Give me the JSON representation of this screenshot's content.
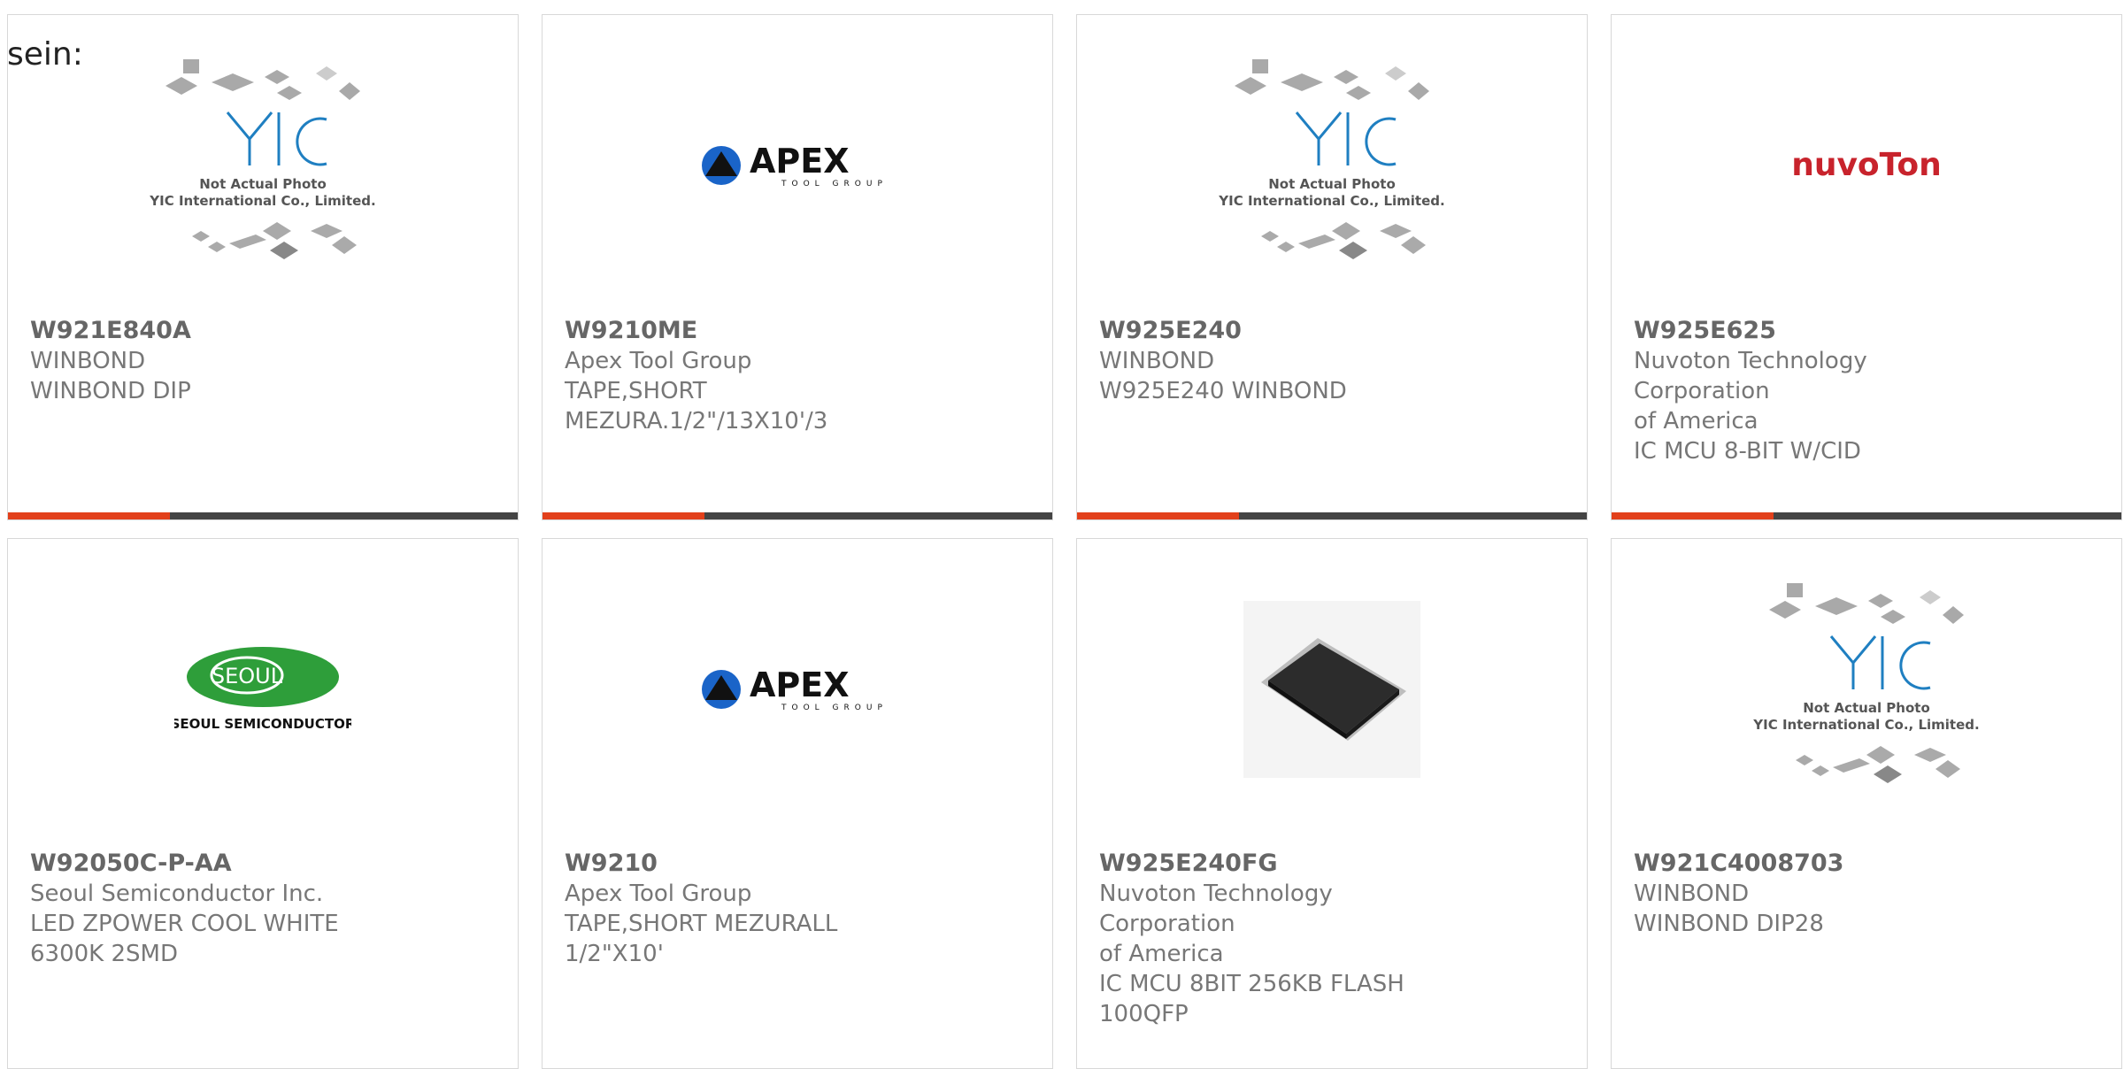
{
  "lead_text": "sein:",
  "yic_placeholder": {
    "line1": "Not Actual Photo",
    "line2": "YIC International Co., Limited."
  },
  "colors": {
    "accent": "#e2401b",
    "bar": "#444444",
    "text": "#666666"
  },
  "products": [
    {
      "part": "W921E840A",
      "maker": "WINBOND",
      "desc1": "WINBOND DIP",
      "desc2": "",
      "desc3": "",
      "image": "yic-placeholder"
    },
    {
      "part": "W9210ME",
      "maker": "Apex Tool Group",
      "desc1": "TAPE,SHORT",
      "desc2": "MEZURA.1/2\"/13X10'/3",
      "desc3": "",
      "image": "apex-logo"
    },
    {
      "part": "W925E240",
      "maker": "WINBOND",
      "desc1": "W925E240 WINBOND",
      "desc2": "",
      "desc3": "",
      "image": "yic-placeholder"
    },
    {
      "part": "W925E625",
      "maker": "Nuvoton Technology Corporation",
      "desc1": "of America",
      "desc2": "IC MCU 8-BIT W/CID",
      "desc3": "",
      "image": "nuvoton-logo"
    },
    {
      "part": "W92050C-P-AA",
      "maker": "Seoul Semiconductor Inc.",
      "desc1": "LED ZPOWER COOL WHITE",
      "desc2": "6300K 2SMD",
      "desc3": "",
      "image": "seoul-logo"
    },
    {
      "part": "W9210",
      "maker": "Apex Tool Group",
      "desc1": "TAPE,SHORT MEZURALL 1/2\"X10'",
      "desc2": "",
      "desc3": "",
      "image": "apex-logo"
    },
    {
      "part": "W925E240FG",
      "maker": "Nuvoton Technology Corporation",
      "desc1": "of America",
      "desc2": "IC MCU 8BIT 256KB FLASH",
      "desc3": "100QFP",
      "image": "qfp-chip-photo"
    },
    {
      "part": "W921C4008703",
      "maker": "WINBOND",
      "desc1": "WINBOND DIP28",
      "desc2": "",
      "desc3": "",
      "image": "yic-placeholder"
    }
  ],
  "logos": {
    "apex": {
      "word": "APEX",
      "tag": "TOOL GROUP"
    },
    "nuvoton": {
      "word": "nuvoTon"
    },
    "seoul": {
      "word": "SEOUL",
      "tag": "SEOUL SEMICONDUCTOR"
    }
  }
}
